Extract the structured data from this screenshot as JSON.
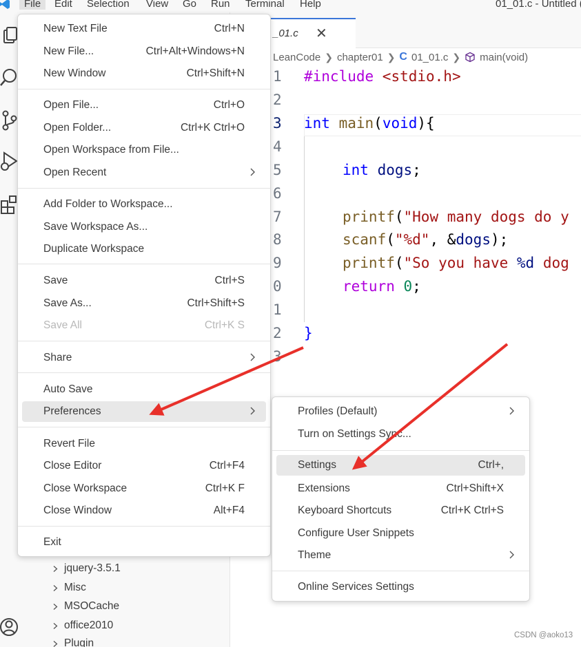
{
  "menubar": {
    "items": [
      "File",
      "Edit",
      "Selection",
      "View",
      "Go",
      "Run",
      "Terminal",
      "Help"
    ],
    "window_title": "01_01.c - Untitled ("
  },
  "activity_icons": [
    "explorer-icon",
    "search-icon",
    "source-control-icon",
    "run-debug-icon",
    "extensions-icon",
    "account-icon"
  ],
  "explorer": {
    "items": [
      "jquery-3.5.1",
      "Misc",
      "MSOCache",
      "office2010",
      "Plugin"
    ]
  },
  "editor": {
    "tab": {
      "label": "_01.c",
      "close": "✕"
    },
    "breadcrumb": [
      "LeanCode",
      "chapter01",
      "01_01.c",
      "main(void)"
    ],
    "breadcrumb_file_icon": "C",
    "line_numbers": [
      "1",
      "2",
      "3",
      "4",
      "5",
      "6",
      "7",
      "8",
      "9",
      "0",
      "1",
      "2",
      "3"
    ],
    "current_line": "3",
    "code": {
      "l1_directive": "#include",
      "l1_header": " <stdio.h>",
      "l3_type": "int",
      "l3_name": " main",
      "l3_paren1": "(",
      "l3_void": "void",
      "l3_rest": "){",
      "l5_type": "int",
      "l5_var": " dogs",
      "l5_end": ";",
      "l7_fn": "printf",
      "l7_paren": "(",
      "l7_str": "\"How many dogs do y",
      "l8_fn": "scanf",
      "l8_paren": "(",
      "l8_str": "\"%d\"",
      "l8_mid": ", &",
      "l8_var": "dogs",
      "l8_end": ");",
      "l9_fn": "printf",
      "l9_paren": "(",
      "l9_str": "\"So you have ",
      "l9_fmt": "%d",
      "l9_str2": " dog",
      "l10_kw": "return",
      "l10_sp": " ",
      "l10_num": "0",
      "l10_end": ";",
      "l12_brace": "}"
    }
  },
  "file_menu": {
    "group1": [
      {
        "label": "New Text File",
        "shortcut": "Ctrl+N"
      },
      {
        "label": "New File...",
        "shortcut": "Ctrl+Alt+Windows+N"
      },
      {
        "label": "New Window",
        "shortcut": "Ctrl+Shift+N"
      }
    ],
    "group2": [
      {
        "label": "Open File...",
        "shortcut": "Ctrl+O"
      },
      {
        "label": "Open Folder...",
        "shortcut": "Ctrl+K Ctrl+O"
      },
      {
        "label": "Open Workspace from File...",
        "shortcut": ""
      },
      {
        "label": "Open Recent",
        "shortcut": ""
      }
    ],
    "group3": [
      {
        "label": "Add Folder to Workspace...",
        "shortcut": ""
      },
      {
        "label": "Save Workspace As...",
        "shortcut": ""
      },
      {
        "label": "Duplicate Workspace",
        "shortcut": ""
      }
    ],
    "group4": [
      {
        "label": "Save",
        "shortcut": "Ctrl+S"
      },
      {
        "label": "Save As...",
        "shortcut": "Ctrl+Shift+S"
      },
      {
        "label": "Save All",
        "shortcut": "Ctrl+K S"
      }
    ],
    "group5": [
      {
        "label": "Share",
        "shortcut": ""
      }
    ],
    "group6": [
      {
        "label": "Auto Save",
        "shortcut": ""
      },
      {
        "label": "Preferences",
        "shortcut": ""
      }
    ],
    "group7": [
      {
        "label": "Revert File",
        "shortcut": ""
      },
      {
        "label": "Close Editor",
        "shortcut": "Ctrl+F4"
      },
      {
        "label": "Close Workspace",
        "shortcut": "Ctrl+K F"
      },
      {
        "label": "Close Window",
        "shortcut": "Alt+F4"
      }
    ],
    "group8": [
      {
        "label": "Exit",
        "shortcut": ""
      }
    ]
  },
  "preferences_menu": {
    "group1": [
      {
        "label": "Profiles (Default)",
        "shortcut": ""
      },
      {
        "label": "Turn on Settings Sync...",
        "shortcut": ""
      }
    ],
    "group2": [
      {
        "label": "Settings",
        "shortcut": "Ctrl+,"
      },
      {
        "label": "Extensions",
        "shortcut": "Ctrl+Shift+X"
      },
      {
        "label": "Keyboard Shortcuts",
        "shortcut": "Ctrl+K Ctrl+S"
      },
      {
        "label": "Configure User Snippets",
        "shortcut": ""
      },
      {
        "label": "Theme",
        "shortcut": ""
      }
    ],
    "group3": [
      {
        "label": "Online Services Settings",
        "shortcut": ""
      }
    ]
  },
  "colors": {
    "annotation_arrow": "#e8302a",
    "accent": "#3b76d9",
    "menu_highlight": "#e8e8e8"
  },
  "watermark": "CSDN @aoko13"
}
